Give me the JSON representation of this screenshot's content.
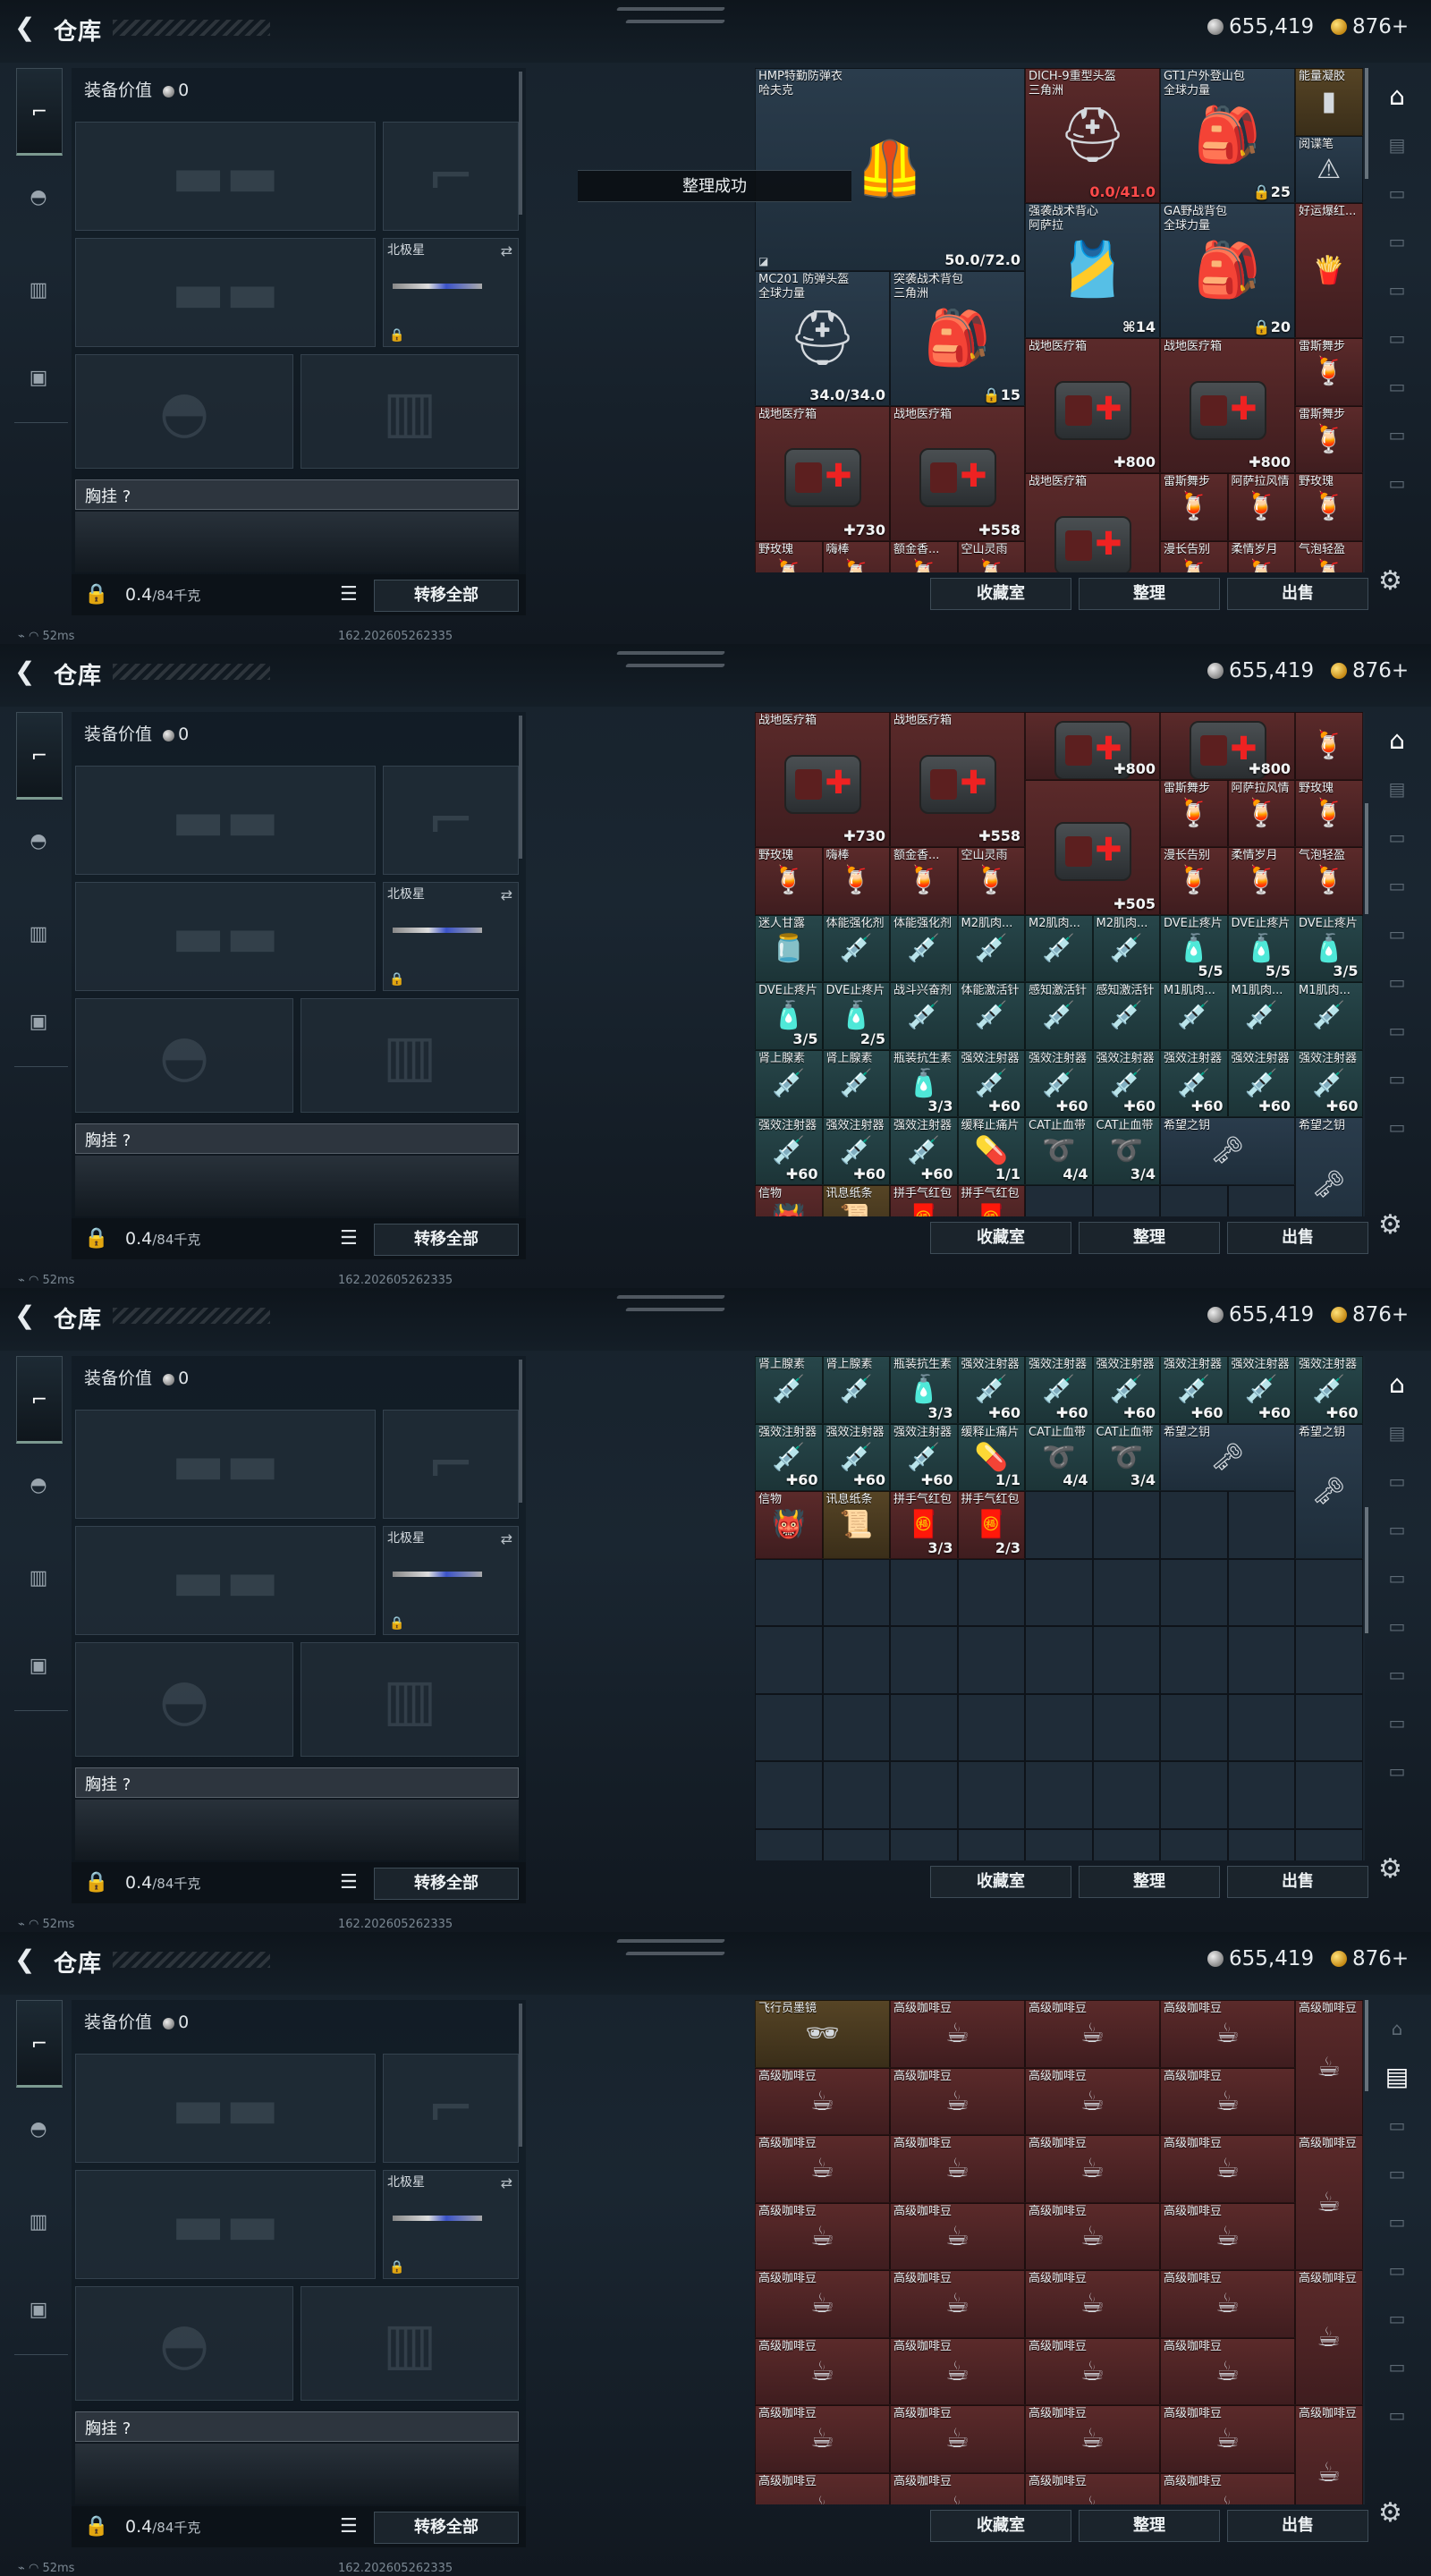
{
  "app": {
    "title": "仓库",
    "back_icon": "back-arrow-icon",
    "silver": "655,419",
    "gold": "876+"
  },
  "left_nav": [
    "gun-icon",
    "helmet-icon",
    "vest-icon",
    "backpack-icon"
  ],
  "equipment": {
    "value_label": "装备价值",
    "value": "0",
    "melee_label": "北极星",
    "chest_label": "胸挂 ?",
    "weight": "0.4",
    "weight_unit": "/84千克",
    "transfer_all": "转移全部"
  },
  "actions": {
    "collection": "收藏室",
    "sort": "整理",
    "sell": "出售"
  },
  "toast": "整理成功",
  "status": {
    "ping": "52ms",
    "build": "162.2026052623​35"
  },
  "frames": [
    {
      "scroll": [
        0,
        0.22
      ],
      "right_nav_active": 0,
      "cells": [
        {
          "r": 0,
          "c": 0,
          "w": 4,
          "h": 3,
          "col": "blue",
          "n": "HMP特勤防弹衣",
          "n2": "哈夫克",
          "ct": "50.0/72.0",
          "ic": "armor",
          "bl": "◪"
        },
        {
          "r": 0,
          "c": 4,
          "w": 2,
          "h": 2,
          "col": "red",
          "n": "DICH-9重型头盔",
          "n2": "三角洲",
          "ct": "0.0/41.0",
          "bad": true,
          "ic": "helmet"
        },
        {
          "r": 0,
          "c": 6,
          "w": 2,
          "h": 2,
          "col": "blue",
          "n": "GT1户外登山包",
          "n2": "全球力量",
          "ct": "🔒25",
          "ic": "backpack"
        },
        {
          "r": 0,
          "c": 8,
          "w": 1,
          "h": 1,
          "col": "gold",
          "n": "能量凝胶",
          "ic": "gel"
        },
        {
          "r": 1,
          "c": 8,
          "w": 1,
          "h": 1,
          "col": "blue",
          "n": "阅谍笔",
          "ic": "warn"
        },
        {
          "r": 2,
          "c": 4,
          "w": 2,
          "h": 2,
          "col": "blue",
          "n": "强袭战术背心",
          "n2": "阿萨拉",
          "ct": "⌘14",
          "ic": "vest"
        },
        {
          "r": 2,
          "c": 6,
          "w": 2,
          "h": 2,
          "col": "blue",
          "n": "GA野战背包",
          "n2": "全球力量",
          "ct": "🔒20",
          "ic": "backpack"
        },
        {
          "r": 2,
          "c": 8,
          "w": 1,
          "h": 2,
          "col": "red",
          "n": "好运爆红...",
          "ic": "snack"
        },
        {
          "r": 3,
          "c": 0,
          "w": 2,
          "h": 2,
          "col": "blue",
          "n": "MC201 防弹头盔",
          "n2": "全球力量",
          "ct": "34.0/34.0",
          "ic": "helmet"
        },
        {
          "r": 3,
          "c": 2,
          "w": 2,
          "h": 2,
          "col": "blue",
          "n": "突袭战术背包",
          "n2": "三角洲",
          "ct": "🔒15",
          "ic": "backpack"
        },
        {
          "r": 4,
          "c": 4,
          "w": 2,
          "h": 2,
          "col": "red",
          "n": "战地医疗箱",
          "ct": "✚800",
          "ic": "medkit"
        },
        {
          "r": 4,
          "c": 6,
          "w": 2,
          "h": 2,
          "col": "red",
          "n": "战地医疗箱",
          "ct": "✚800",
          "ic": "medkit"
        },
        {
          "r": 4,
          "c": 8,
          "w": 1,
          "h": 1,
          "col": "red",
          "n": "雷斯舞步",
          "ic": "drink"
        },
        {
          "r": 5,
          "c": 0,
          "w": 2,
          "h": 2,
          "col": "red",
          "n": "战地医疗箱",
          "ct": "✚730",
          "ic": "medkit"
        },
        {
          "r": 5,
          "c": 2,
          "w": 2,
          "h": 2,
          "col": "red",
          "n": "战地医疗箱",
          "ct": "✚558",
          "ic": "medkit"
        },
        {
          "r": 5,
          "c": 8,
          "w": 1,
          "h": 1,
          "col": "red",
          "n": "雷斯舞步",
          "ic": "drink"
        },
        {
          "r": 6,
          "c": 4,
          "w": 2,
          "h": 2,
          "col": "red",
          "n": "战地医疗箱",
          "ic": "medkit"
        },
        {
          "r": 6,
          "c": 6,
          "w": 1,
          "h": 1,
          "col": "red",
          "n": "雷斯舞步",
          "ic": "drink"
        },
        {
          "r": 6,
          "c": 7,
          "w": 1,
          "h": 1,
          "col": "red",
          "n": "阿萨拉风情",
          "ic": "drink"
        },
        {
          "r": 6,
          "c": 8,
          "w": 1,
          "h": 1,
          "col": "red",
          "n": "野玫瑰",
          "ic": "drink"
        },
        {
          "r": 7,
          "c": 0,
          "w": 1,
          "h": 1,
          "col": "red",
          "n": "野玫瑰",
          "ic": "drink"
        },
        {
          "r": 7,
          "c": 1,
          "w": 1,
          "h": 1,
          "col": "red",
          "n": "嗨棒",
          "ic": "drink"
        },
        {
          "r": 7,
          "c": 2,
          "w": 1,
          "h": 1,
          "col": "red",
          "n": "额金香...",
          "ic": "drink"
        },
        {
          "r": 7,
          "c": 3,
          "w": 1,
          "h": 1,
          "col": "red",
          "n": "空山灵雨",
          "ic": "drink"
        },
        {
          "r": 7,
          "c": 6,
          "w": 1,
          "h": 1,
          "col": "red",
          "n": "漫长告别",
          "ic": "drink"
        },
        {
          "r": 7,
          "c": 7,
          "w": 1,
          "h": 1,
          "col": "red",
          "n": "柔情岁月",
          "ic": "drink"
        },
        {
          "r": 7,
          "c": 8,
          "w": 1,
          "h": 1,
          "col": "red",
          "n": "气泡轻盈",
          "ic": "drink"
        }
      ]
    },
    {
      "scroll": [
        0.18,
        0.4
      ],
      "right_nav_active": 0,
      "cells": [
        {
          "r": 0,
          "c": 0,
          "w": 2,
          "h": 2,
          "col": "red",
          "n": "战地医疗箱",
          "ct": "✚730",
          "ic": "medkit"
        },
        {
          "r": 0,
          "c": 2,
          "w": 2,
          "h": 2,
          "col": "red",
          "n": "战地医疗箱",
          "ct": "✚558",
          "ic": "medkit"
        },
        {
          "r": 0,
          "c": 4,
          "w": 2,
          "h": 1,
          "col": "red",
          "n": "",
          "ct": "✚800",
          "ic": "medkit"
        },
        {
          "r": 0,
          "c": 6,
          "w": 2,
          "h": 1,
          "col": "red",
          "n": "",
          "ct": "✚800",
          "ic": "medkit"
        },
        {
          "r": 0,
          "c": 8,
          "w": 1,
          "h": 1,
          "col": "red",
          "n": "",
          "ic": "drink"
        },
        {
          "r": 1,
          "c": 4,
          "w": 2,
          "h": 2,
          "col": "red",
          "n": "",
          "ct": "✚505",
          "ic": "medkit"
        },
        {
          "r": 1,
          "c": 6,
          "w": 1,
          "h": 1,
          "col": "red",
          "n": "雷斯舞步",
          "ic": "drink"
        },
        {
          "r": 1,
          "c": 7,
          "w": 1,
          "h": 1,
          "col": "red",
          "n": "阿萨拉风情",
          "ic": "drink"
        },
        {
          "r": 1,
          "c": 8,
          "w": 1,
          "h": 1,
          "col": "red",
          "n": "野玫瑰",
          "ic": "drink"
        },
        {
          "r": 2,
          "c": 0,
          "w": 1,
          "h": 1,
          "col": "red",
          "n": "野玫瑰",
          "ic": "drink"
        },
        {
          "r": 2,
          "c": 1,
          "w": 1,
          "h": 1,
          "col": "red",
          "n": "嗨棒",
          "ic": "drink"
        },
        {
          "r": 2,
          "c": 2,
          "w": 1,
          "h": 1,
          "col": "red",
          "n": "额金香...",
          "ic": "drink"
        },
        {
          "r": 2,
          "c": 3,
          "w": 1,
          "h": 1,
          "col": "red",
          "n": "空山灵雨",
          "ic": "drink"
        },
        {
          "r": 2,
          "c": 6,
          "w": 1,
          "h": 1,
          "col": "red",
          "n": "漫长告别",
          "ic": "drink"
        },
        {
          "r": 2,
          "c": 7,
          "w": 1,
          "h": 1,
          "col": "red",
          "n": "柔情岁月",
          "ic": "drink"
        },
        {
          "r": 2,
          "c": 8,
          "w": 1,
          "h": 1,
          "col": "red",
          "n": "气泡轻盈",
          "ic": "drink"
        },
        {
          "r": 3,
          "c": 0,
          "w": 1,
          "h": 1,
          "col": "teal",
          "n": "迷人甘露",
          "ic": "jar"
        },
        {
          "r": 3,
          "c": 1,
          "w": 1,
          "h": 1,
          "col": "teal",
          "n": "体能强化剂",
          "ic": "syringe"
        },
        {
          "r": 3,
          "c": 2,
          "w": 1,
          "h": 1,
          "col": "teal",
          "n": "体能强化剂",
          "ic": "syringe"
        },
        {
          "r": 3,
          "c": 3,
          "w": 1,
          "h": 1,
          "col": "teal",
          "n": "M2肌肉...",
          "ic": "syringe"
        },
        {
          "r": 3,
          "c": 4,
          "w": 1,
          "h": 1,
          "col": "teal",
          "n": "M2肌肉...",
          "ic": "syringe"
        },
        {
          "r": 3,
          "c": 5,
          "w": 1,
          "h": 1,
          "col": "teal",
          "n": "M2肌肉...",
          "ic": "syringe"
        },
        {
          "r": 3,
          "c": 6,
          "w": 1,
          "h": 1,
          "col": "teal",
          "n": "DVE止疼片",
          "ct": "5/5",
          "ic": "bottle"
        },
        {
          "r": 3,
          "c": 7,
          "w": 1,
          "h": 1,
          "col": "teal",
          "n": "DVE止疼片",
          "ct": "5/5",
          "ic": "bottle"
        },
        {
          "r": 3,
          "c": 8,
          "w": 1,
          "h": 1,
          "col": "teal",
          "n": "DVE止疼片",
          "ct": "3/5",
          "ic": "bottle"
        },
        {
          "r": 4,
          "c": 0,
          "w": 1,
          "h": 1,
          "col": "teal",
          "n": "DVE止疼片",
          "ct": "3/5",
          "ic": "bottle"
        },
        {
          "r": 4,
          "c": 1,
          "w": 1,
          "h": 1,
          "col": "teal",
          "n": "DVE止疼片",
          "ct": "2/5",
          "ic": "bottle"
        },
        {
          "r": 4,
          "c": 2,
          "w": 1,
          "h": 1,
          "col": "teal",
          "n": "战斗兴奋剂",
          "ic": "syringe"
        },
        {
          "r": 4,
          "c": 3,
          "w": 1,
          "h": 1,
          "col": "teal",
          "n": "体能激活针",
          "ic": "syringe"
        },
        {
          "r": 4,
          "c": 4,
          "w": 1,
          "h": 1,
          "col": "teal",
          "n": "感知激活针",
          "ic": "syringe"
        },
        {
          "r": 4,
          "c": 5,
          "w": 1,
          "h": 1,
          "col": "teal",
          "n": "感知激活针",
          "ic": "syringe"
        },
        {
          "r": 4,
          "c": 6,
          "w": 1,
          "h": 1,
          "col": "teal",
          "n": "M1肌肉...",
          "ic": "syringe"
        },
        {
          "r": 4,
          "c": 7,
          "w": 1,
          "h": 1,
          "col": "teal",
          "n": "M1肌肉...",
          "ic": "syringe"
        },
        {
          "r": 4,
          "c": 8,
          "w": 1,
          "h": 1,
          "col": "teal",
          "n": "M1肌肉...",
          "ic": "syringe"
        },
        {
          "r": 5,
          "c": 0,
          "w": 1,
          "h": 1,
          "col": "teal",
          "n": "肾上腺素",
          "ic": "syringe"
        },
        {
          "r": 5,
          "c": 1,
          "w": 1,
          "h": 1,
          "col": "teal",
          "n": "肾上腺素",
          "ic": "syringe"
        },
        {
          "r": 5,
          "c": 2,
          "w": 1,
          "h": 1,
          "col": "teal",
          "n": "瓶装抗生素",
          "ct": "3/3",
          "ic": "bottle"
        },
        {
          "r": 5,
          "c": 3,
          "w": 1,
          "h": 1,
          "col": "teal",
          "n": "强效注射器",
          "ct": "✚60",
          "ic": "syringe"
        },
        {
          "r": 5,
          "c": 4,
          "w": 1,
          "h": 1,
          "col": "teal",
          "n": "强效注射器",
          "ct": "✚60",
          "ic": "syringe"
        },
        {
          "r": 5,
          "c": 5,
          "w": 1,
          "h": 1,
          "col": "teal",
          "n": "强效注射器",
          "ct": "✚60",
          "ic": "syringe"
        },
        {
          "r": 5,
          "c": 6,
          "w": 1,
          "h": 1,
          "col": "teal",
          "n": "强效注射器",
          "ct": "✚60",
          "ic": "syringe"
        },
        {
          "r": 5,
          "c": 7,
          "w": 1,
          "h": 1,
          "col": "teal",
          "n": "强效注射器",
          "ct": "✚60",
          "ic": "syringe"
        },
        {
          "r": 5,
          "c": 8,
          "w": 1,
          "h": 1,
          "col": "teal",
          "n": "强效注射器",
          "ct": "✚60",
          "ic": "syringe"
        },
        {
          "r": 6,
          "c": 0,
          "w": 1,
          "h": 1,
          "col": "teal",
          "n": "强效注射器",
          "ct": "✚60",
          "ic": "syringe"
        },
        {
          "r": 6,
          "c": 1,
          "w": 1,
          "h": 1,
          "col": "teal",
          "n": "强效注射器",
          "ct": "✚60",
          "ic": "syringe"
        },
        {
          "r": 6,
          "c": 2,
          "w": 1,
          "h": 1,
          "col": "teal",
          "n": "强效注射器",
          "ct": "✚60",
          "ic": "syringe"
        },
        {
          "r": 6,
          "c": 3,
          "w": 1,
          "h": 1,
          "col": "teal",
          "n": "缓释止痛片",
          "ct": "1/1",
          "ic": "pills"
        },
        {
          "r": 6,
          "c": 4,
          "w": 1,
          "h": 1,
          "col": "teal",
          "n": "CAT止血带",
          "ct": "4/4",
          "ic": "band"
        },
        {
          "r": 6,
          "c": 5,
          "w": 1,
          "h": 1,
          "col": "teal",
          "n": "CAT止血带",
          "ct": "3/4",
          "ic": "band"
        },
        {
          "r": 6,
          "c": 6,
          "w": 2,
          "h": 1,
          "col": "blue",
          "n": "希望之钥",
          "ic": "key"
        },
        {
          "r": 6,
          "c": 8,
          "w": 1,
          "h": 2,
          "col": "blue",
          "n": "希望之钥",
          "ic": "key2"
        },
        {
          "r": 7,
          "c": 0,
          "w": 1,
          "h": 1,
          "col": "red",
          "n": "信物",
          "ic": "mask"
        },
        {
          "r": 7,
          "c": 1,
          "w": 1,
          "h": 1,
          "col": "gold",
          "n": "讯息纸条",
          "ic": "paper"
        },
        {
          "r": 7,
          "c": 2,
          "w": 1,
          "h": 1,
          "col": "red",
          "n": "拼手气红包",
          "ic": "envelope"
        },
        {
          "r": 7,
          "c": 3,
          "w": 1,
          "h": 1,
          "col": "red",
          "n": "拼手气红包",
          "ic": "envelope"
        }
      ]
    },
    {
      "scroll": [
        0.3,
        0.55
      ],
      "right_nav_active": 0,
      "cells": [
        {
          "r": 0,
          "c": 0,
          "w": 1,
          "h": 1,
          "col": "teal",
          "n": "肾上腺素",
          "ic": "syringe"
        },
        {
          "r": 0,
          "c": 1,
          "w": 1,
          "h": 1,
          "col": "teal",
          "n": "肾上腺素",
          "ic": "syringe"
        },
        {
          "r": 0,
          "c": 2,
          "w": 1,
          "h": 1,
          "col": "teal",
          "n": "瓶装抗生素",
          "ct": "3/3",
          "ic": "bottle"
        },
        {
          "r": 0,
          "c": 3,
          "w": 1,
          "h": 1,
          "col": "teal",
          "n": "强效注射器",
          "ct": "✚60",
          "ic": "syringe"
        },
        {
          "r": 0,
          "c": 4,
          "w": 1,
          "h": 1,
          "col": "teal",
          "n": "强效注射器",
          "ct": "✚60",
          "ic": "syringe"
        },
        {
          "r": 0,
          "c": 5,
          "w": 1,
          "h": 1,
          "col": "teal",
          "n": "强效注射器",
          "ct": "✚60",
          "ic": "syringe"
        },
        {
          "r": 0,
          "c": 6,
          "w": 1,
          "h": 1,
          "col": "teal",
          "n": "强效注射器",
          "ct": "✚60",
          "ic": "syringe"
        },
        {
          "r": 0,
          "c": 7,
          "w": 1,
          "h": 1,
          "col": "teal",
          "n": "强效注射器",
          "ct": "✚60",
          "ic": "syringe"
        },
        {
          "r": 0,
          "c": 8,
          "w": 1,
          "h": 1,
          "col": "teal",
          "n": "强效注射器",
          "ct": "✚60",
          "ic": "syringe"
        },
        {
          "r": 1,
          "c": 0,
          "w": 1,
          "h": 1,
          "col": "teal",
          "n": "强效注射器",
          "ct": "✚60",
          "ic": "syringe"
        },
        {
          "r": 1,
          "c": 1,
          "w": 1,
          "h": 1,
          "col": "teal",
          "n": "强效注射器",
          "ct": "✚60",
          "ic": "syringe"
        },
        {
          "r": 1,
          "c": 2,
          "w": 1,
          "h": 1,
          "col": "teal",
          "n": "强效注射器",
          "ct": "✚60",
          "ic": "syringe"
        },
        {
          "r": 1,
          "c": 3,
          "w": 1,
          "h": 1,
          "col": "teal",
          "n": "缓释止痛片",
          "ct": "1/1",
          "ic": "pills"
        },
        {
          "r": 1,
          "c": 4,
          "w": 1,
          "h": 1,
          "col": "teal",
          "n": "CAT止血带",
          "ct": "4/4",
          "ic": "band"
        },
        {
          "r": 1,
          "c": 5,
          "w": 1,
          "h": 1,
          "col": "teal",
          "n": "CAT止血带",
          "ct": "3/4",
          "ic": "band"
        },
        {
          "r": 1,
          "c": 6,
          "w": 2,
          "h": 1,
          "col": "blue",
          "n": "希望之钥",
          "ic": "key"
        },
        {
          "r": 1,
          "c": 8,
          "w": 1,
          "h": 2,
          "col": "blue",
          "n": "希望之钥",
          "ic": "key2"
        },
        {
          "r": 2,
          "c": 0,
          "w": 1,
          "h": 1,
          "col": "red",
          "n": "信物",
          "ic": "mask"
        },
        {
          "r": 2,
          "c": 1,
          "w": 1,
          "h": 1,
          "col": "gold",
          "n": "讯息纸条",
          "ic": "paper"
        },
        {
          "r": 2,
          "c": 2,
          "w": 1,
          "h": 1,
          "col": "red",
          "n": "拼手气红包",
          "ct": "3/3",
          "ic": "envelope"
        },
        {
          "r": 2,
          "c": 3,
          "w": 1,
          "h": 1,
          "col": "red",
          "n": "拼手气红包",
          "ct": "2/3",
          "ic": "envelope"
        }
      ]
    },
    {
      "scroll": [
        0,
        0.18
      ],
      "right_nav_active": 1,
      "cells": "coffee"
    }
  ],
  "coffee": {
    "first": "飞行员墨镜",
    "name": "高级咖啡豆"
  }
}
